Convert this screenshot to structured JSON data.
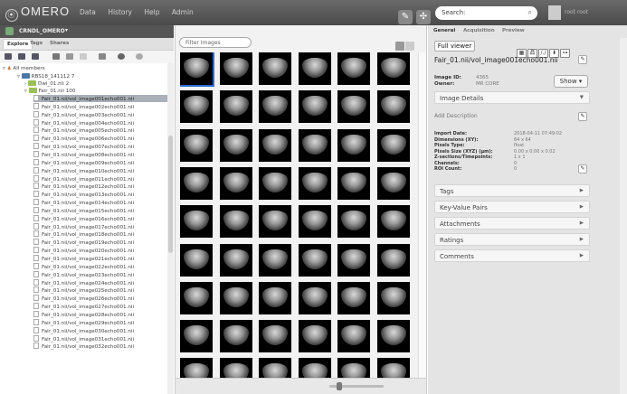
{
  "topbar": {
    "logo": "OMERO",
    "nav": [
      "Data",
      "History",
      "Help",
      "Admin"
    ],
    "search_placeholder": "Search:",
    "username": "root root"
  },
  "group": {
    "name": "CRNDL_OMERO"
  },
  "left_tabs": [
    "Explore",
    "Tags",
    "Shares"
  ],
  "tree": {
    "root": "All members",
    "project": "RBS18_141112 7",
    "datasets": [
      "Dwi_01.nii 2",
      "Fair_01.nii 100"
    ],
    "files": [
      "Fair_01.nii/vol_image001echo001.nii",
      "Fair_01.nii/vol_image002echo001.nii",
      "Fair_01.nii/vol_image003echo001.nii",
      "Fair_01.nii/vol_image004echo001.nii",
      "Fair_01.nii/vol_image005echo001.nii",
      "Fair_01.nii/vol_image006echo001.nii",
      "Fair_01.nii/vol_image007echo001.nii",
      "Fair_01.nii/vol_image008echo001.nii",
      "Fair_01.nii/vol_image009echo001.nii",
      "Fair_01.nii/vol_image010echo001.nii",
      "Fair_01.nii/vol_image011echo001.nii",
      "Fair_01.nii/vol_image012echo001.nii",
      "Fair_01.nii/vol_image013echo001.nii",
      "Fair_01.nii/vol_image014echo001.nii",
      "Fair_01.nii/vol_image015echo001.nii",
      "Fair_01.nii/vol_image016echo001.nii",
      "Fair_01.nii/vol_image017echo001.nii",
      "Fair_01.nii/vol_image018echo001.nii",
      "Fair_01.nii/vol_image019echo001.nii",
      "Fair_01.nii/vol_image020echo001.nii",
      "Fair_01.nii/vol_image021echo001.nii",
      "Fair_01.nii/vol_image022echo001.nii",
      "Fair_01.nii/vol_image023echo001.nii",
      "Fair_01.nii/vol_image024echo001.nii",
      "Fair_01.nii/vol_image025echo001.nii",
      "Fair_01.nii/vol_image026echo001.nii",
      "Fair_01.nii/vol_image027echo001.nii",
      "Fair_01.nii/vol_image028echo001.nii",
      "Fair_01.nii/vol_image029echo001.nii",
      "Fair_01.nii/vol_image030echo001.nii",
      "Fair_01.nii/vol_image031echo001.nii",
      "Fair_01.nii/vol_image032echo001.nii"
    ]
  },
  "center": {
    "filter_placeholder": "Filter Images"
  },
  "right": {
    "tabs": [
      "General",
      "Acquisition",
      "Preview"
    ],
    "full_viewer": "Full viewer",
    "image_name": "Fair_01.nii/vol_image001echo001.nii",
    "image_id_label": "Image ID:",
    "image_id": "4365",
    "owner_label": "Owner:",
    "owner": "MR CORE",
    "show_label": "Show",
    "image_details": "Image Details",
    "add_description": "Add Description",
    "details": [
      {
        "label": "Import Date:",
        "value": "2018-04-11 07:49:02"
      },
      {
        "label": "Dimensions (XY):",
        "value": "64 x 64"
      },
      {
        "label": "Pixels Type:",
        "value": "float"
      },
      {
        "label": "Pixels Size (XYZ) (µm):",
        "value": "0.00 x 0.00 x 0.02"
      },
      {
        "label": "Z-sections/Timepoints:",
        "value": "1 x 1"
      },
      {
        "label": "Channels:",
        "value": "0"
      },
      {
        "label": "ROI Count:",
        "value": "0"
      }
    ],
    "sections": [
      "Tags",
      "Key-Value Pairs",
      "Attachments",
      "Ratings",
      "Comments"
    ]
  },
  "colors": {
    "selection": "#2b6cd4",
    "folder": "#9bbf59",
    "topbar": "#555555"
  }
}
